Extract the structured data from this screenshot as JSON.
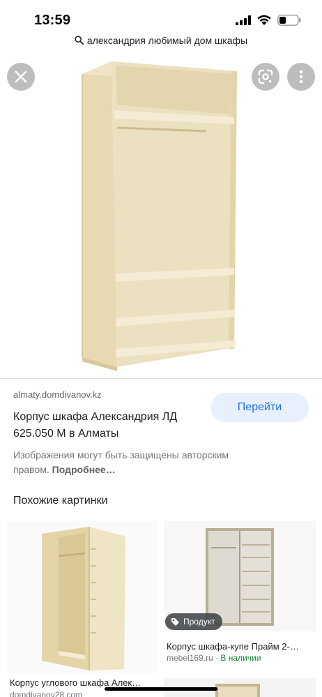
{
  "status_bar": {
    "time": "13:59"
  },
  "search": {
    "query": "александрия любимый дом шкафы"
  },
  "viewer": {
    "close_icon": "close-icon",
    "lens_icon": "google-lens-icon",
    "more_icon": "more-vert-icon"
  },
  "result": {
    "source": "almaty.domdivanov.kz",
    "title": "Корпус шкафа Александрия ЛД 625.050 М в Алматы",
    "visit_label": "Перейти",
    "copyright_text": "Изображения могут быть защищены авторским правом.",
    "copyright_more": "Подробнее…"
  },
  "related": {
    "section_title": "Похожие картинки",
    "items": [
      {
        "caption": "Корпус углового шкафа Алек…",
        "source": "domdivanov28.com"
      },
      {
        "badge": "Продукт",
        "caption": "Корпус шкафа-купе Прайм 2-…",
        "source": "mebel169.ru",
        "separator": "·",
        "stock": "В наличии"
      }
    ]
  },
  "colors": {
    "accent": "#1a73e8",
    "button_bg": "#e8f0fe",
    "stock_green": "#188038",
    "wood": "#eadfbf"
  }
}
